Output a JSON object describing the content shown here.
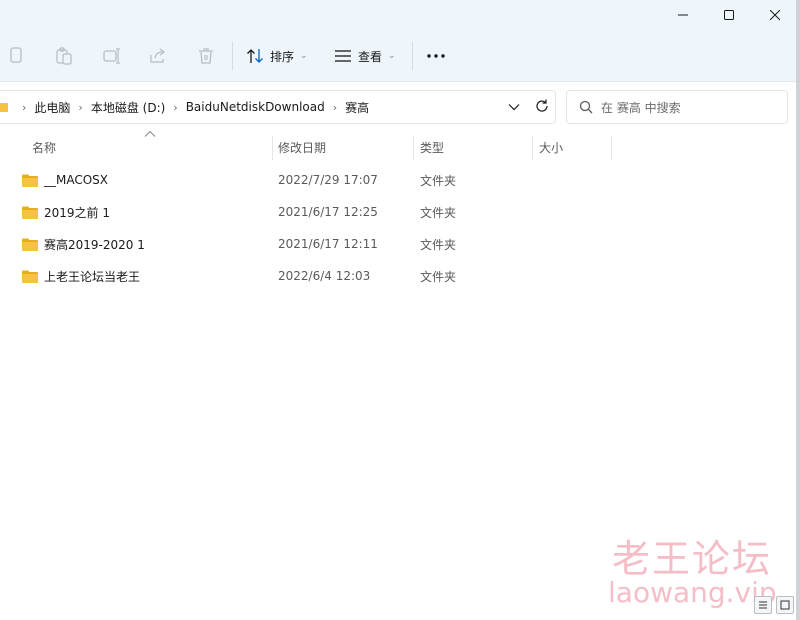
{
  "window": {
    "controls": [
      "minimize-icon",
      "maximize-icon",
      "close-icon"
    ]
  },
  "toolbar": {
    "icons": [
      "copy-icon",
      "paste-icon",
      "rename-icon",
      "share-icon",
      "delete-icon"
    ],
    "sort_label": "排序",
    "view_label": "查看",
    "more_icon": "more-icon"
  },
  "address": {
    "crumbs": [
      "此电脑",
      "本地磁盘 (D:)",
      "BaiduNetdiskDownload",
      "赛高"
    ]
  },
  "search": {
    "placeholder": "在 赛高 中搜索"
  },
  "columns": {
    "name": "名称",
    "date": "修改日期",
    "type": "类型",
    "size": "大小"
  },
  "files": [
    {
      "name": "__MACOSX",
      "date": "2022/7/29 17:07",
      "type": "文件夹"
    },
    {
      "name": "2019之前 1",
      "date": "2021/6/17 12:25",
      "type": "文件夹"
    },
    {
      "name": "赛高2019-2020 1",
      "date": "2021/6/17 12:11",
      "type": "文件夹"
    },
    {
      "name": "上老王论坛当老王",
      "date": "2022/6/4 12:03",
      "type": "文件夹"
    }
  ],
  "watermark": {
    "cn": "老王论坛",
    "en": "laowang.vip"
  },
  "colors": {
    "toolbar_bg": "#eef5fb",
    "folder": "#f5c242",
    "accent": "#0067c0",
    "watermark": "#e96e82"
  }
}
